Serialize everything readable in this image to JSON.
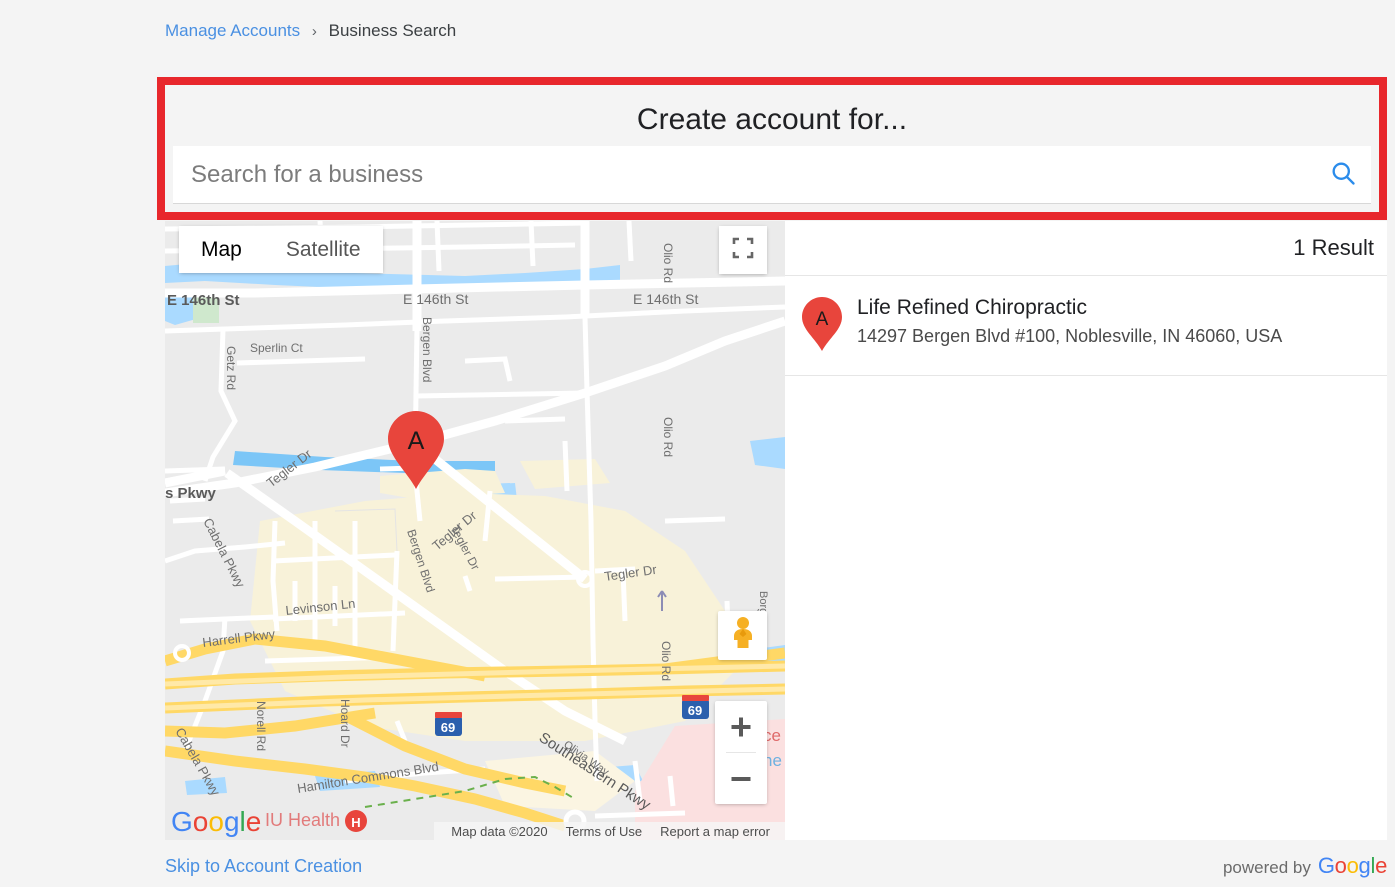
{
  "breadcrumb": {
    "parent_label": "Manage Accounts",
    "separator": "›",
    "current_label": "Business Search"
  },
  "search_panel": {
    "title": "Create account for...",
    "input_value": "",
    "input_placeholder": "Search for a business",
    "search_icon": "search-icon",
    "highlight_color": "#e8272c"
  },
  "map": {
    "type_buttons": [
      {
        "label": "Map",
        "active": true
      },
      {
        "label": "Satellite",
        "active": false
      }
    ],
    "fullscreen_icon": "fullscreen-icon",
    "pegman_icon": "street-view-pegman-icon",
    "zoom_in_label": "+",
    "zoom_out_label": "−",
    "logo_text": "Google",
    "attribution": {
      "map_data": "Map data ©2020",
      "terms": "Terms of Use",
      "report": "Report a map error"
    },
    "marker_label": "A",
    "marker_color": "#e8453c",
    "background_color": "#ebebeb",
    "labels": [
      "E 146th St",
      "E 146th St",
      "E 146th St",
      "Getz Rd",
      "Sperlin Ct",
      "Bergen Blvd",
      "Bergen Blvd",
      "Olio Rd",
      "Olio Rd",
      "Olio Rd",
      "Tegler Dr",
      "Tegler Dr",
      "Tegler Dr",
      "Tegler Dr",
      "s Pkwy",
      "Cabela Pkwy",
      "Cabela Pkwy",
      "Levinson Ln",
      "Harrell Pkwy",
      "Norell Rd",
      "Hoard Dr",
      "Olivia Way",
      "Southeastern Pkwy",
      "Hamilton Commons Blvd",
      "Borg",
      "IU Health",
      "69",
      "69"
    ]
  },
  "results": {
    "count_label": "1 Result",
    "items": [
      {
        "pin_label": "A",
        "name": "Life Refined Chiropractic",
        "address": "14297 Bergen Blvd #100, Noblesville, IN 46060, USA"
      }
    ]
  },
  "footer": {
    "skip_label": "Skip to Account Creation",
    "powered_by_label": "powered by",
    "brand": "Google"
  }
}
